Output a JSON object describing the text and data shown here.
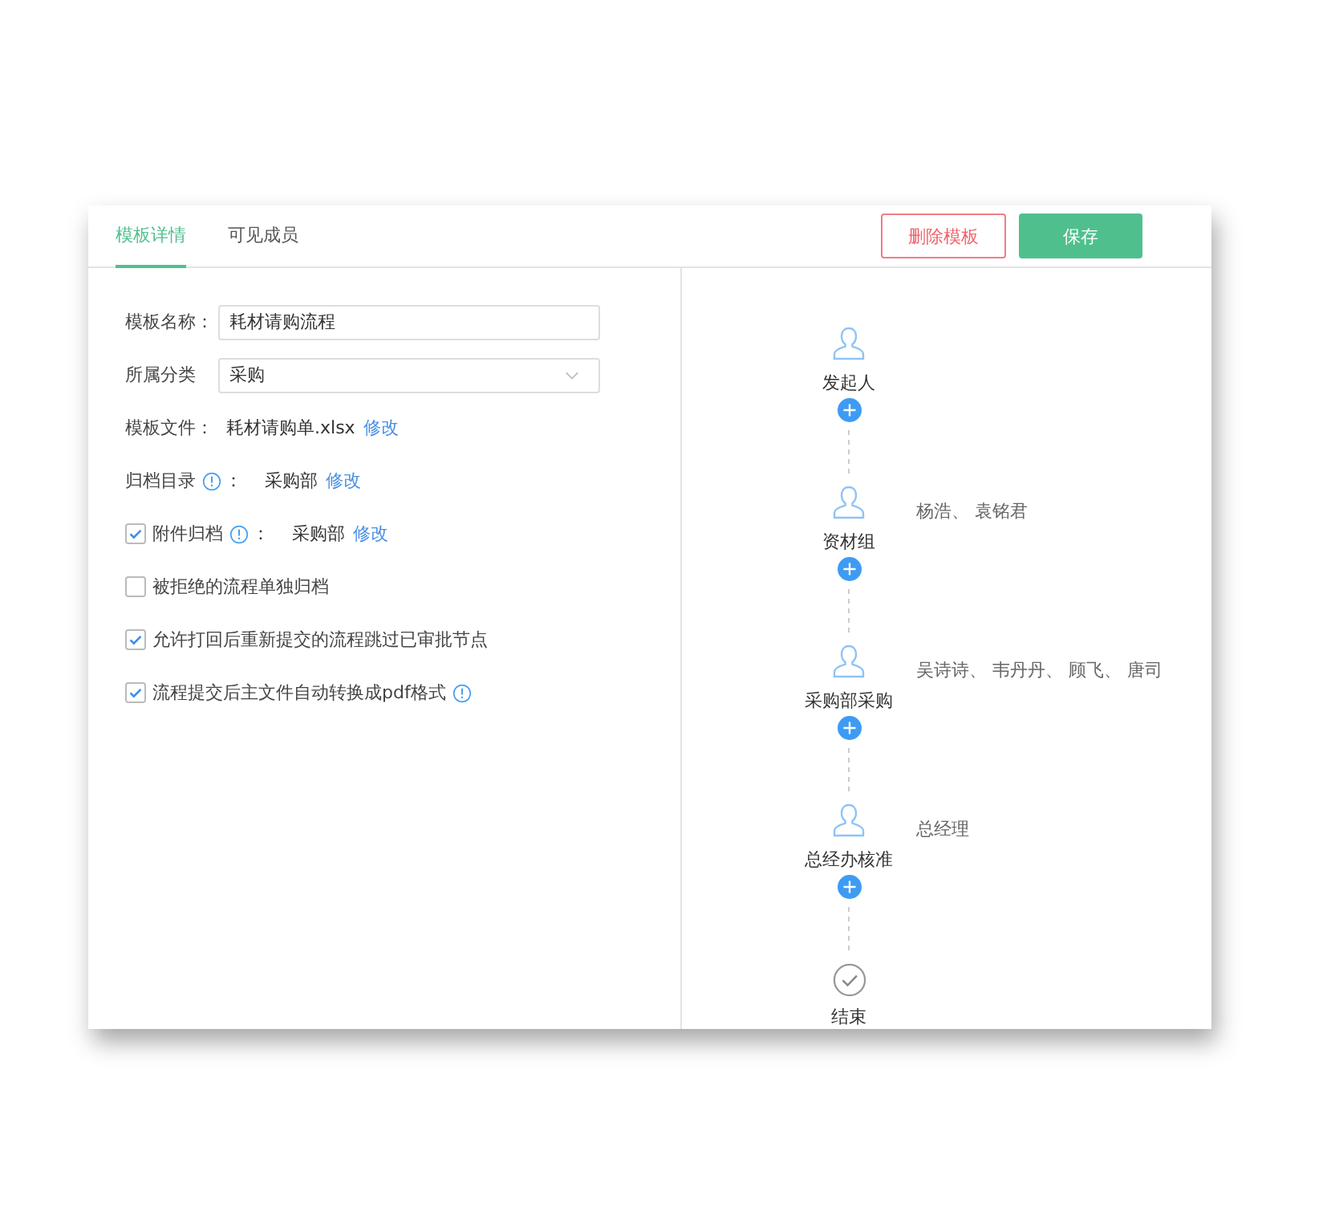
{
  "tabs": [
    {
      "label": "模板详情",
      "selected": true
    },
    {
      "label": "可见成员",
      "selected": false
    }
  ],
  "buttons": [
    {
      "kind": "danger",
      "label": "删除模板"
    },
    {
      "kind": "primary",
      "label": "保存"
    }
  ],
  "form": [
    {
      "kind": "text",
      "label": "模板名称：",
      "value": "耗材请购流程"
    },
    {
      "kind": "select",
      "label": "所属分类",
      "value": "采购"
    },
    {
      "kind": "file",
      "label": "模板文件：",
      "value": "耗材请购单.xlsx",
      "link": "修改"
    },
    {
      "kind": "option",
      "label": "归档目录",
      "info": true,
      "suffix": "：",
      "value": "采购部",
      "link": "修改"
    },
    {
      "kind": "option",
      "checked": true,
      "label": "附件归档",
      "info": true,
      "suffix": "：",
      "value": "采购部",
      "link": "修改"
    },
    {
      "kind": "option",
      "checked": false,
      "label": "被拒绝的流程单独归档"
    },
    {
      "kind": "option",
      "checked": true,
      "label": "允许打回后重新提交的流程跳过已审批节点"
    },
    {
      "kind": "option",
      "checked": true,
      "label": "流程提交后主文件自动转换成pdf格式",
      "info": true
    }
  ],
  "flow": [
    {
      "kind": "person",
      "name": "发起人",
      "add": true
    },
    {
      "kind": "person",
      "name": "资材组",
      "assignees": "杨浩、 袁铭君",
      "add": true
    },
    {
      "kind": "person",
      "name": "采购部采购",
      "assignees": "吴诗诗、 韦丹丹、 顾飞、 唐司",
      "add": true
    },
    {
      "kind": "person",
      "name": "总经办核准",
      "assignees": "总经理",
      "add": true
    },
    {
      "kind": "end",
      "name": "结束"
    }
  ]
}
